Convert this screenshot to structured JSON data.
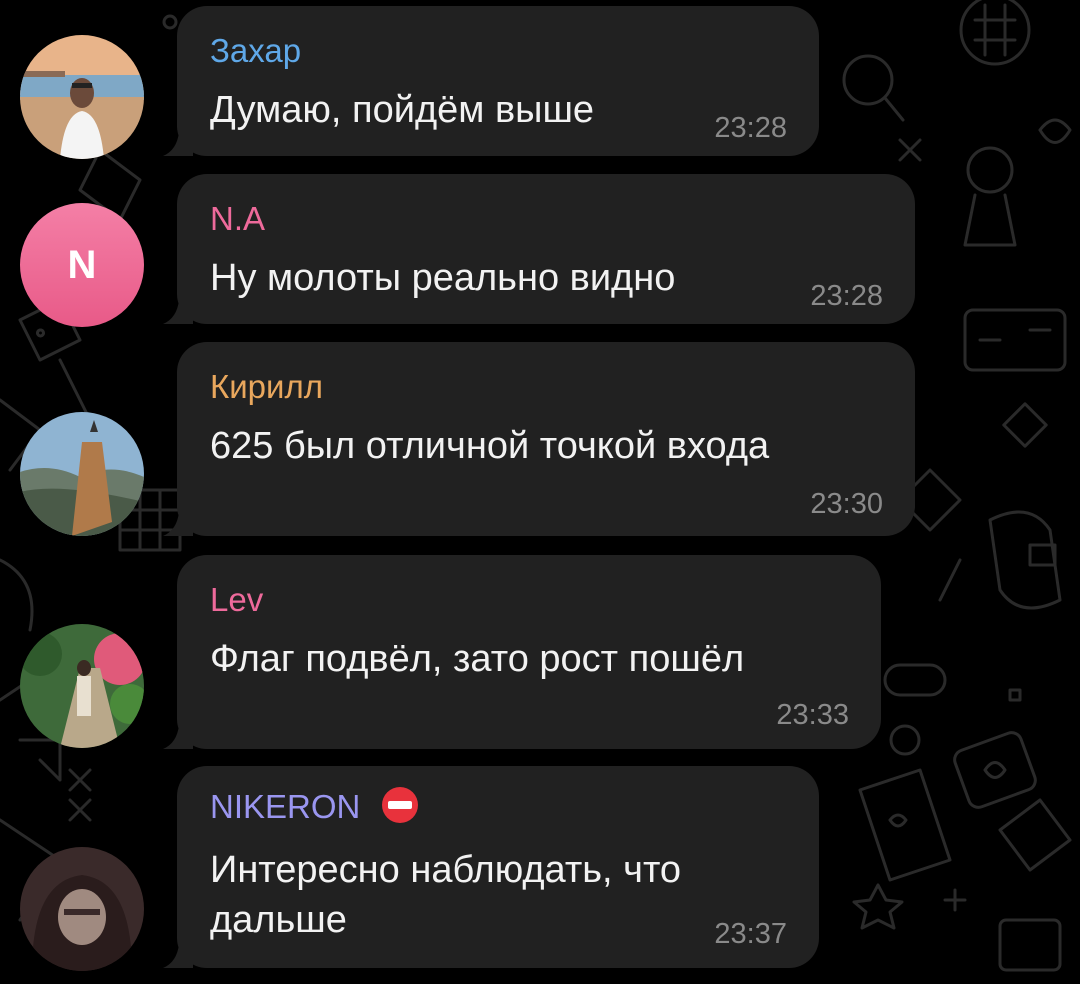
{
  "theme": {
    "background": "#000000",
    "bubble": "#212121",
    "text": "#f2f2f2",
    "time": "#8a8a8a"
  },
  "messages": [
    {
      "sender": "Захар",
      "sender_color": "#5fa8e8",
      "text": "Думаю, пойдём выше",
      "time": "23:28",
      "avatar": "photo-beach"
    },
    {
      "sender": "N.A",
      "sender_color": "#ee6a9b",
      "text": "Ну молоты реально видно",
      "time": "23:28",
      "avatar_initial": "N",
      "avatar_color": "#ea5f8a"
    },
    {
      "sender": "Кирилл",
      "sender_color": "#e9a75d",
      "text": "625 был отличной точкой входа",
      "time": "23:30",
      "avatar": "photo-cliff"
    },
    {
      "sender": "Lev",
      "sender_color": "#ee6a9b",
      "text": "Флаг подвёл, зато рост пошёл",
      "time": "23:33",
      "avatar": "photo-garden"
    },
    {
      "sender": "NIKERON",
      "sender_color": "#9a96f0",
      "sender_badge": "no-entry-icon",
      "text_line1": "Интересно наблюдать, что",
      "text_line2": "дальше",
      "time": "23:37",
      "avatar": "photo-hood"
    }
  ]
}
